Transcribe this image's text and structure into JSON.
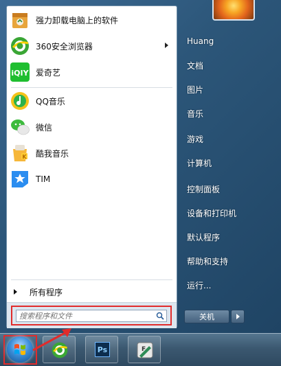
{
  "start_menu": {
    "programs": [
      {
        "label": "强力卸载电脑上的软件",
        "icon": "uninstall-box-icon"
      },
      {
        "label": "360安全浏览器",
        "icon": "360-browser-icon",
        "has_submenu": true
      },
      {
        "label": "爱奇艺",
        "icon": "iqiyi-icon"
      },
      {
        "label": "QQ音乐",
        "icon": "qq-music-icon"
      },
      {
        "label": "微信",
        "icon": "wechat-icon"
      },
      {
        "label": "酷我音乐",
        "icon": "kuwo-music-icon"
      },
      {
        "label": "TIM",
        "icon": "tim-icon"
      }
    ],
    "all_programs_label": "所有程序",
    "search": {
      "placeholder": "搜索程序和文件"
    },
    "right_items": [
      "Huang",
      "文档",
      "图片",
      "音乐",
      "游戏",
      "计算机",
      "控制面板",
      "设备和打印机",
      "默认程序",
      "帮助和支持",
      "运行..."
    ],
    "shutdown_label": "关机"
  },
  "taskbar": {
    "items": [
      {
        "icon": "windows-start-orb-icon"
      },
      {
        "icon": "360-browser-icon"
      },
      {
        "icon": "photoshop-icon",
        "text": "Ps"
      },
      {
        "icon": "feed-editor-icon"
      }
    ]
  },
  "colors": {
    "highlight": "#e12b2b",
    "accent_green": "#3aa635"
  }
}
